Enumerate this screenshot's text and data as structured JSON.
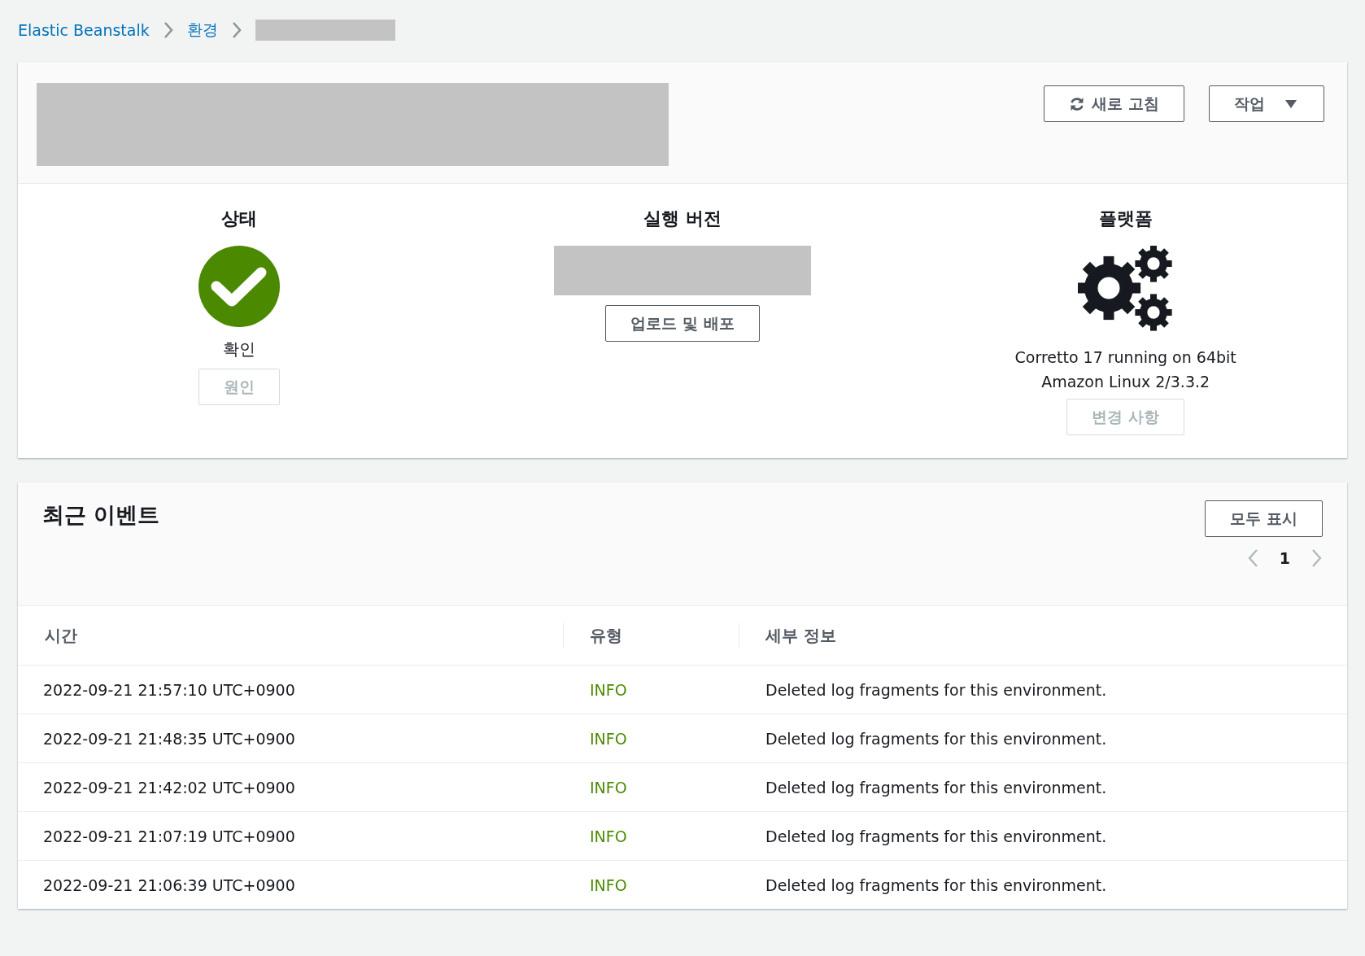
{
  "breadcrumbs": [
    {
      "label": "Elastic Beanstalk"
    },
    {
      "label": "환경"
    }
  ],
  "header": {
    "buttons": [
      {
        "label": "새로 고침",
        "kind": "refresh"
      },
      {
        "label": "작업",
        "kind": "dropdown"
      }
    ]
  },
  "summary": [
    {
      "kind": "health",
      "title": "상태",
      "status": "확인",
      "button": {
        "label": "원인",
        "disabled": true
      }
    },
    {
      "kind": "version",
      "title": "실행 버전",
      "button": {
        "label": "업로드 및 배포",
        "disabled": false
      }
    },
    {
      "kind": "platform",
      "title": "플랫폼",
      "description": [
        "Corretto 17 running on 64bit",
        "Amazon Linux 2/3.3.2"
      ],
      "button": {
        "label": "변경 사항",
        "disabled": true
      }
    }
  ],
  "events": {
    "title": "최근 이벤트",
    "show_all": "모두 표시",
    "page": "1",
    "columns": [
      "시간",
      "유형",
      "세부 정보"
    ],
    "rows": [
      {
        "time": "2022-09-21 21:57:10 UTC+0900",
        "type": "INFO",
        "details": "Deleted log fragments for this environment."
      },
      {
        "time": "2022-09-21 21:48:35 UTC+0900",
        "type": "INFO",
        "details": "Deleted log fragments for this environment."
      },
      {
        "time": "2022-09-21 21:42:02 UTC+0900",
        "type": "INFO",
        "details": "Deleted log fragments for this environment."
      },
      {
        "time": "2022-09-21 21:07:19 UTC+0900",
        "type": "INFO",
        "details": "Deleted log fragments for this environment."
      },
      {
        "time": "2022-09-21 21:06:39 UTC+0900",
        "type": "INFO",
        "details": "Deleted log fragments for this environment."
      }
    ]
  }
}
